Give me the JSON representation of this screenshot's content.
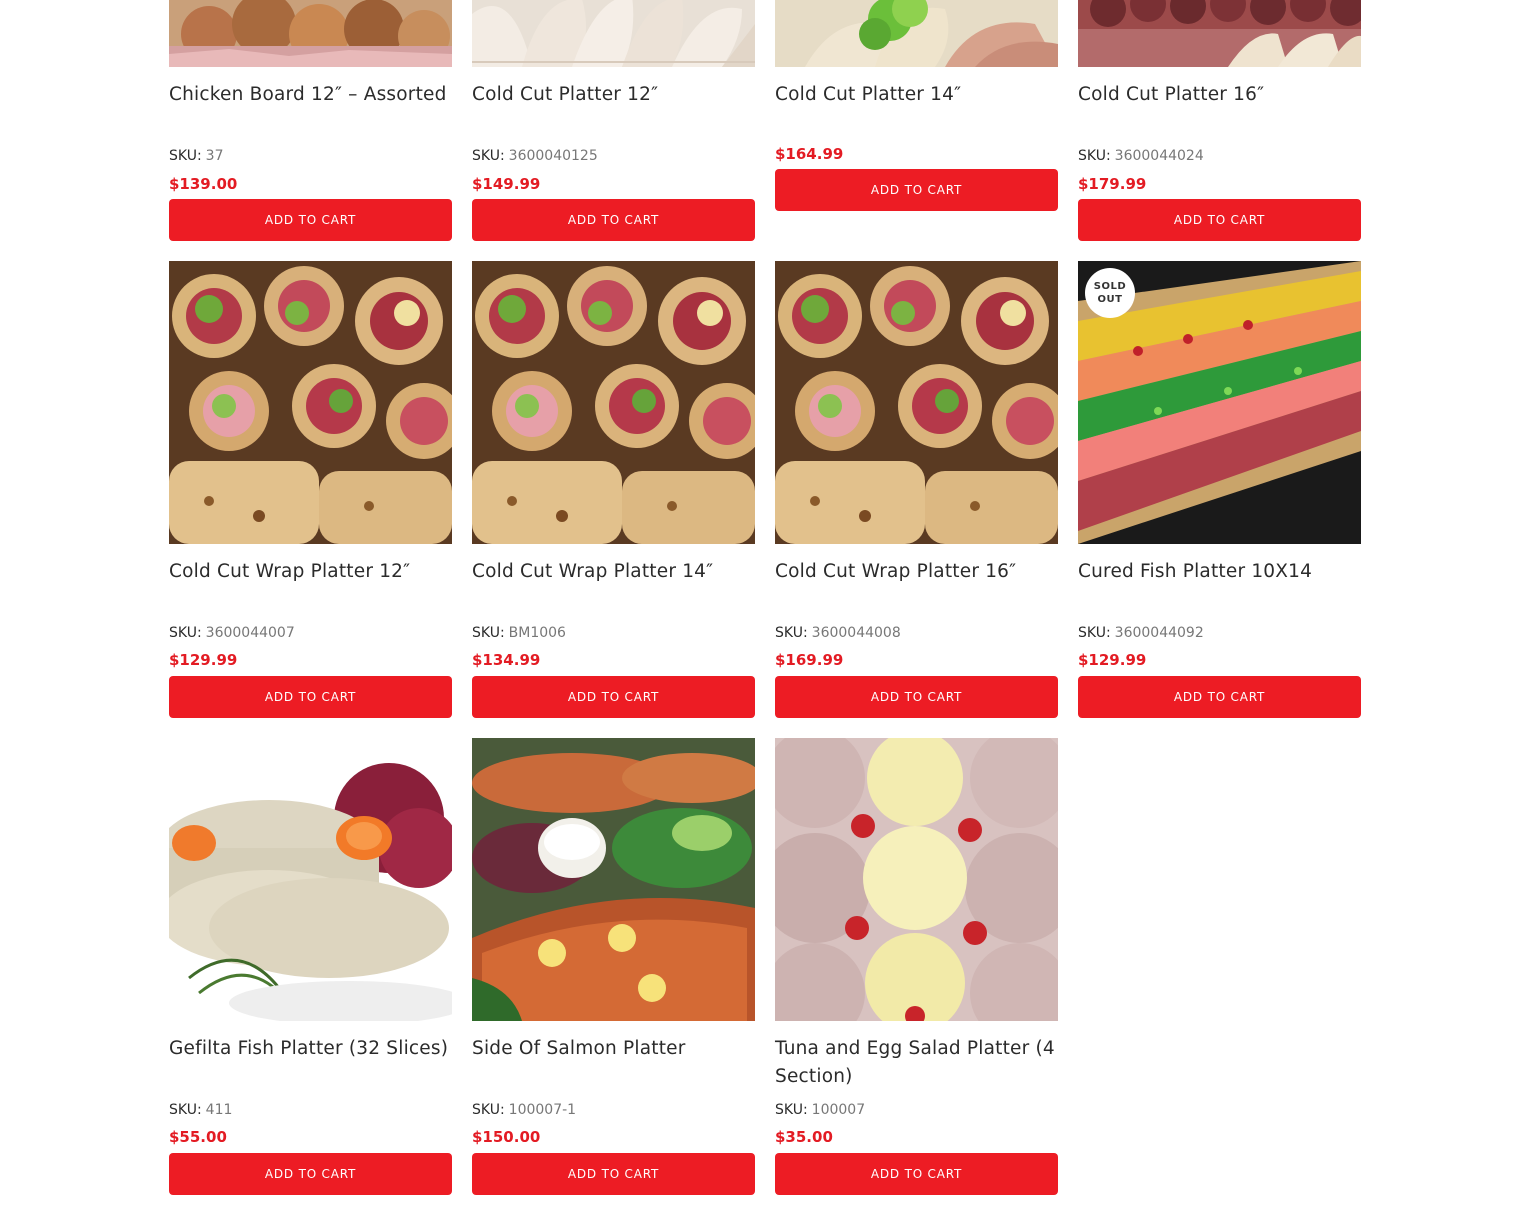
{
  "colors": {
    "accent": "#ed1c24",
    "price": "#e31b23",
    "title": "#2b2b2b"
  },
  "sku_label": "SKU:",
  "add_to_cart_label": "ADD TO CART",
  "products": [
    {
      "title": "Chicken Board 12″ – Assorted",
      "sku": "37",
      "price": "$139.00",
      "image": "chicken-board-image"
    },
    {
      "title": "Cold Cut Platter 12″",
      "sku": "3600040125",
      "price": "$149.99",
      "image": "cold-cut-platter-image"
    },
    {
      "title": "Cold Cut Platter 14″",
      "sku": "",
      "price": "$164.99",
      "image": "cold-cut-platter-image"
    },
    {
      "title": "Cold Cut Platter 16″",
      "sku": "3600044024",
      "price": "$179.99",
      "image": "cold-cut-platter-image"
    },
    {
      "title": "Cold Cut Wrap Platter 12″",
      "sku": "3600044007",
      "price": "$129.99",
      "image": "wrap-platter-image"
    },
    {
      "title": "Cold Cut Wrap Platter 14″",
      "sku": "BM1006",
      "price": "$134.99",
      "image": "wrap-platter-image"
    },
    {
      "title": "Cold Cut Wrap Platter 16″",
      "sku": "3600044008",
      "price": "$169.99",
      "image": "wrap-platter-image"
    },
    {
      "title": "Cured Fish Platter 10X14",
      "sku": "3600044092",
      "price": "$129.99",
      "image": "cured-fish-image",
      "badge": [
        "SOLD",
        "OUT"
      ]
    },
    {
      "title": "Gefilta Fish Platter (32 Slices)",
      "sku": "411",
      "price": "$55.00",
      "image": "gefilte-fish-image"
    },
    {
      "title": "Side Of Salmon Platter",
      "sku": "100007-1",
      "price": "$150.00",
      "image": "salmon-platter-image"
    },
    {
      "title": "Tuna and Egg Salad Platter (4 Section)",
      "sku": "100007",
      "price": "$35.00",
      "image": "tuna-egg-salad-image"
    }
  ]
}
